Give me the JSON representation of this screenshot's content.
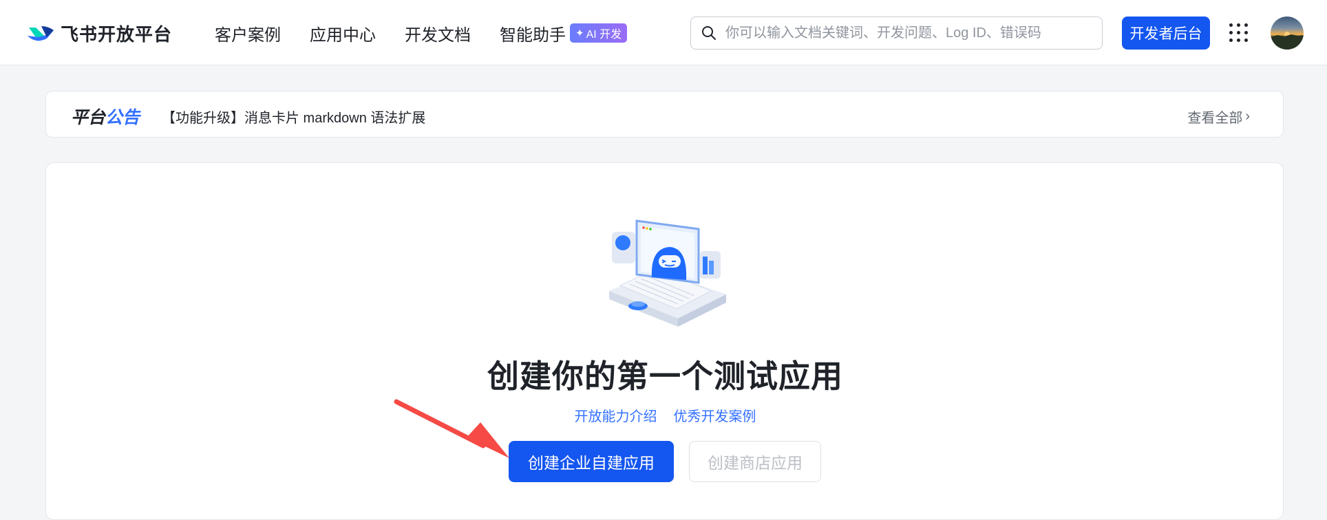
{
  "header": {
    "logo_text": "飞书开放平台",
    "nav": [
      {
        "label": "客户案例"
      },
      {
        "label": "应用中心"
      },
      {
        "label": "开发文档"
      },
      {
        "label": "智能助手",
        "badge": "AI 开发"
      }
    ],
    "search_placeholder": "你可以输入文档关键词、开发问题、Log ID、错误码",
    "dev_console_label": "开发者后台",
    "apps_icon": "grid-dots-icon",
    "avatar_icon": "user-avatar"
  },
  "announcement": {
    "title_part1": "平台",
    "title_part2": "公告",
    "text": "【功能升级】消息卡片 markdown 语法扩展",
    "view_all": "查看全部"
  },
  "main": {
    "illustration": "robot-laptop-illustration",
    "headline": "创建你的第一个测试应用",
    "links": [
      "开放能力介绍",
      "优秀开发案例"
    ],
    "primary_button": "创建企业自建应用",
    "secondary_button": "创建商店应用",
    "annotation": "red-arrow-pointer"
  },
  "colors": {
    "brand_blue": "#1456f0",
    "link_blue": "#3370ff",
    "annotation_red": "#f54a45"
  }
}
